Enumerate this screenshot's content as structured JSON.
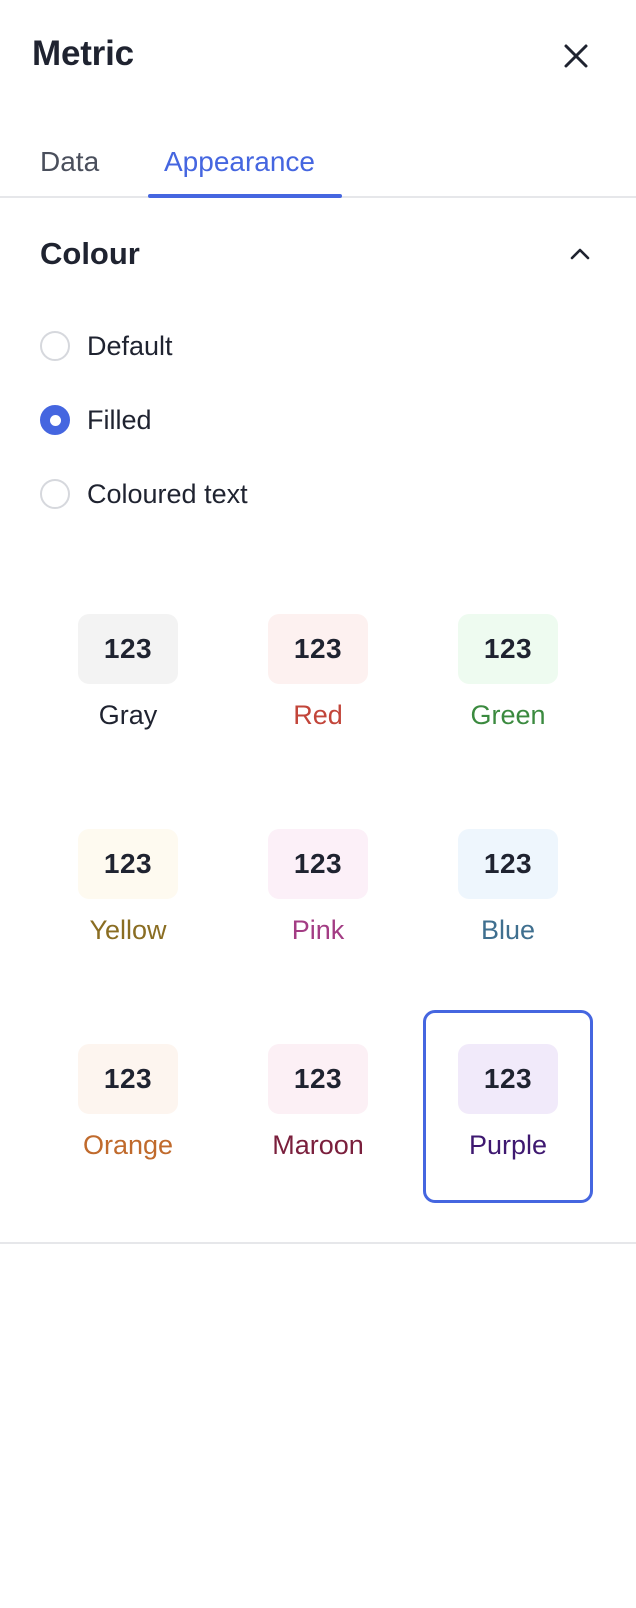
{
  "header": {
    "title": "Metric"
  },
  "tabs": [
    {
      "label": "Data",
      "active": false
    },
    {
      "label": "Appearance",
      "active": true
    }
  ],
  "section": {
    "title": "Colour",
    "expanded": true
  },
  "colour_mode": {
    "options": [
      {
        "label": "Default",
        "checked": false
      },
      {
        "label": "Filled",
        "checked": true
      },
      {
        "label": "Coloured text",
        "checked": false
      }
    ]
  },
  "swatches": [
    {
      "sample": "123",
      "label": "Gray",
      "bg": "#f3f3f3",
      "text": "#1f2330",
      "selected": false
    },
    {
      "sample": "123",
      "label": "Red",
      "bg": "#fdf1f0",
      "text": "#c2453a",
      "selected": false
    },
    {
      "sample": "123",
      "label": "Green",
      "bg": "#eefbf0",
      "text": "#3b8a3f",
      "selected": false
    },
    {
      "sample": "123",
      "label": "Yellow",
      "bg": "#fefaf0",
      "text": "#8a6d22",
      "selected": false
    },
    {
      "sample": "123",
      "label": "Pink",
      "bg": "#fcf0f8",
      "text": "#a33c84",
      "selected": false
    },
    {
      "sample": "123",
      "label": "Blue",
      "bg": "#eef6fd",
      "text": "#3f6f8f",
      "selected": false
    },
    {
      "sample": "123",
      "label": "Orange",
      "bg": "#fdf5ef",
      "text": "#c06a2c",
      "selected": false
    },
    {
      "sample": "123",
      "label": "Maroon",
      "bg": "#fcf0f5",
      "text": "#7a1f3c",
      "selected": false
    },
    {
      "sample": "123",
      "label": "Purple",
      "bg": "#f1eafa",
      "text": "#3e1870",
      "selected": true
    }
  ],
  "colors": {
    "accent": "#4566e0",
    "divider": "#e6e7ea"
  },
  "icons": {
    "close": "close-icon",
    "chevron": "chevron-up-icon"
  }
}
